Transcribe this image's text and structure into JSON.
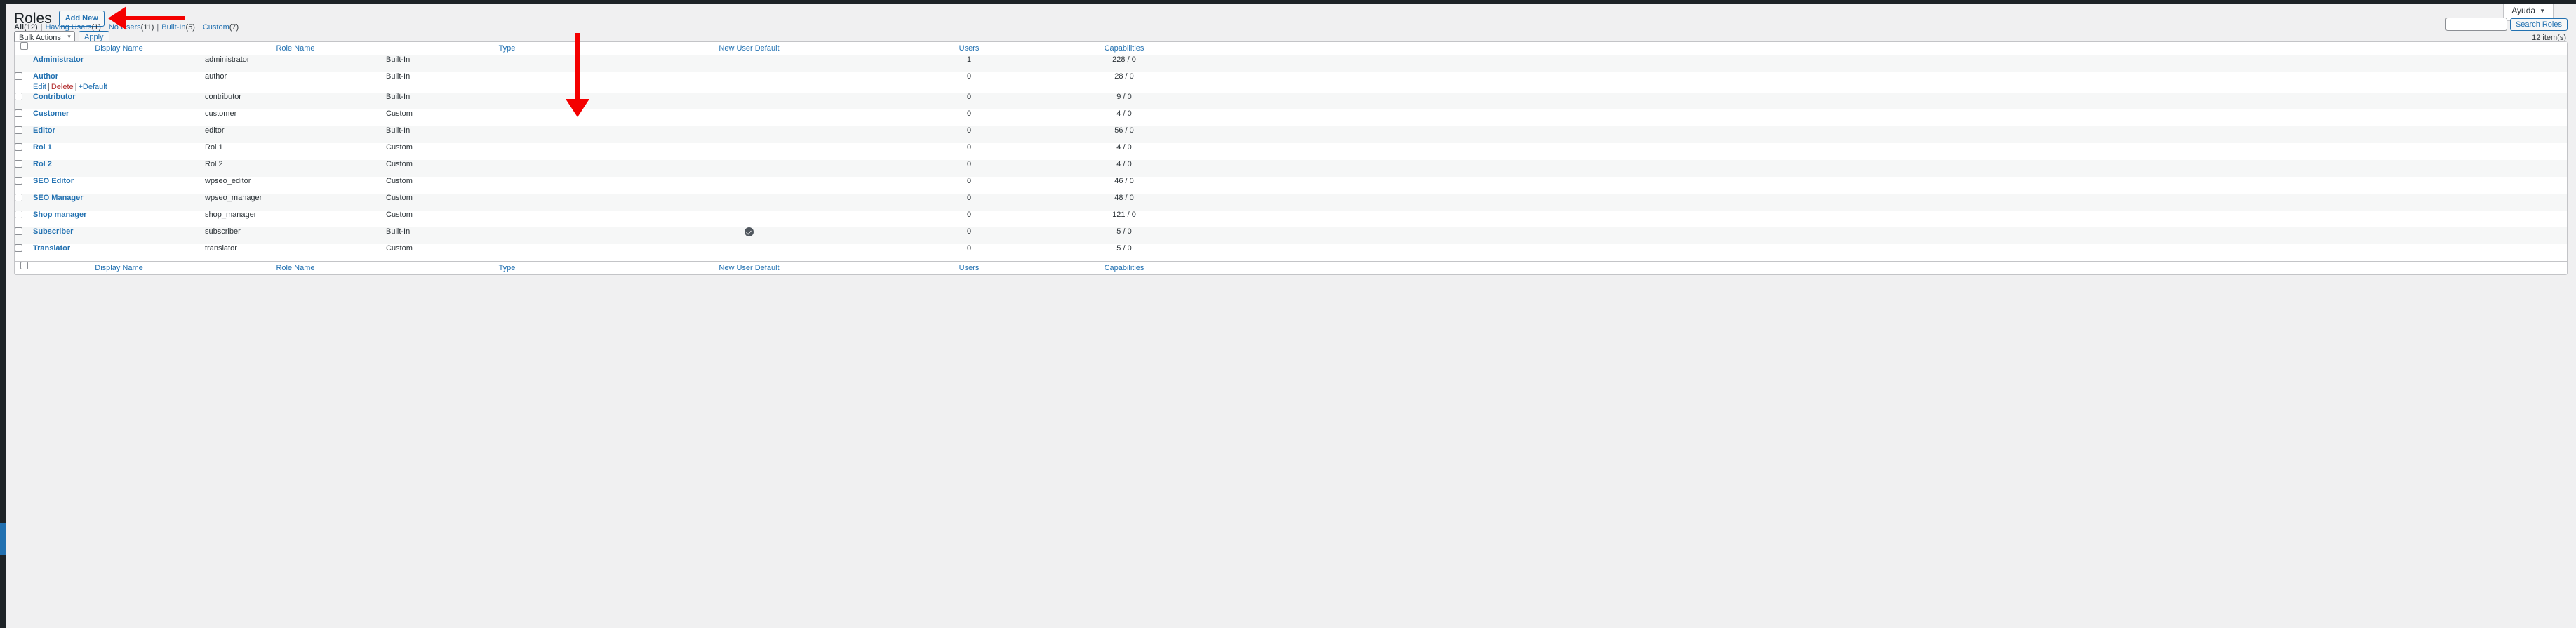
{
  "admin_bar": {
    "help_tab_label": "Ayuda",
    "help_tab_caret": "▼"
  },
  "header": {
    "title": "Roles",
    "add_new_label": "Add New"
  },
  "filters": [
    {
      "label": "All",
      "count": "(12)",
      "current": true
    },
    {
      "label": "Having Users",
      "count": "(1)",
      "current": false
    },
    {
      "label": "No Users",
      "count": "(11)",
      "current": false
    },
    {
      "label": "Built-In",
      "count": "(5)",
      "current": false
    },
    {
      "label": "Custom",
      "count": "(7)",
      "current": false
    }
  ],
  "filter_separator": "|",
  "toolbar": {
    "bulk_actions_label": "Bulk Actions",
    "bulk_actions_caret": "▼",
    "apply_label": "Apply"
  },
  "search": {
    "value": "",
    "placeholder": "",
    "button_label": "Search Roles"
  },
  "item_count": "12 item(s)",
  "table": {
    "columns": [
      {
        "key": "cb",
        "label": ""
      },
      {
        "key": "name",
        "label": "Display Name"
      },
      {
        "key": "role",
        "label": "Role Name"
      },
      {
        "key": "type",
        "label": "Type"
      },
      {
        "key": "newuser",
        "label": "New User Default"
      },
      {
        "key": "users",
        "label": "Users"
      },
      {
        "key": "caps",
        "label": "Capabilities"
      }
    ],
    "rows": [
      {
        "display_name": "Administrator",
        "role_name": "administrator",
        "type": "Built-In",
        "new_user_default": false,
        "users": "1",
        "capabilities": "228 / 0",
        "has_checkbox": false,
        "actions": []
      },
      {
        "display_name": "Author",
        "role_name": "author",
        "type": "Built-In",
        "new_user_default": false,
        "users": "0",
        "capabilities": "28 / 0",
        "has_checkbox": true,
        "actions": [
          {
            "label": "Edit",
            "style": "edit"
          },
          {
            "label": "Delete",
            "style": "delete"
          },
          {
            "label": "+Default",
            "style": "default"
          }
        ]
      },
      {
        "display_name": "Contributor",
        "role_name": "contributor",
        "type": "Built-In",
        "new_user_default": false,
        "users": "0",
        "capabilities": "9 / 0",
        "has_checkbox": true,
        "actions": []
      },
      {
        "display_name": "Customer",
        "role_name": "customer",
        "type": "Custom",
        "new_user_default": false,
        "users": "0",
        "capabilities": "4 / 0",
        "has_checkbox": true,
        "actions": []
      },
      {
        "display_name": "Editor",
        "role_name": "editor",
        "type": "Built-In",
        "new_user_default": false,
        "users": "0",
        "capabilities": "56 / 0",
        "has_checkbox": true,
        "actions": []
      },
      {
        "display_name": "Rol 1",
        "role_name": "Rol 1",
        "type": "Custom",
        "new_user_default": false,
        "users": "0",
        "capabilities": "4 / 0",
        "has_checkbox": true,
        "actions": []
      },
      {
        "display_name": "Rol 2",
        "role_name": "Rol 2",
        "type": "Custom",
        "new_user_default": false,
        "users": "0",
        "capabilities": "4 / 0",
        "has_checkbox": true,
        "actions": []
      },
      {
        "display_name": "SEO Editor",
        "role_name": "wpseo_editor",
        "type": "Custom",
        "new_user_default": false,
        "users": "0",
        "capabilities": "46 / 0",
        "has_checkbox": true,
        "actions": []
      },
      {
        "display_name": "SEO Manager",
        "role_name": "wpseo_manager",
        "type": "Custom",
        "new_user_default": false,
        "users": "0",
        "capabilities": "48 / 0",
        "has_checkbox": true,
        "actions": []
      },
      {
        "display_name": "Shop manager",
        "role_name": "shop_manager",
        "type": "Custom",
        "new_user_default": false,
        "users": "0",
        "capabilities": "121 / 0",
        "has_checkbox": true,
        "actions": []
      },
      {
        "display_name": "Subscriber",
        "role_name": "subscriber",
        "type": "Built-In",
        "new_user_default": true,
        "users": "0",
        "capabilities": "5 / 0",
        "has_checkbox": true,
        "actions": []
      },
      {
        "display_name": "Translator",
        "role_name": "translator",
        "type": "Custom",
        "new_user_default": false,
        "users": "0",
        "capabilities": "5 / 0",
        "has_checkbox": true,
        "actions": []
      }
    ]
  },
  "annotations": {
    "arrow_add_new": "red-left-arrow-pointing-to-add-new-button",
    "arrow_role_name": "red-down-arrow-pointing-to-role-name-column"
  },
  "colors": {
    "link": "#2271b1",
    "delete_link": "#b32d2e",
    "annotation_red": "#f40000",
    "admin_dark": "#1d2327",
    "page_bg": "#f0f0f1",
    "row_alt_bg": "#f6f7f7",
    "border": "#c3c4c7"
  }
}
